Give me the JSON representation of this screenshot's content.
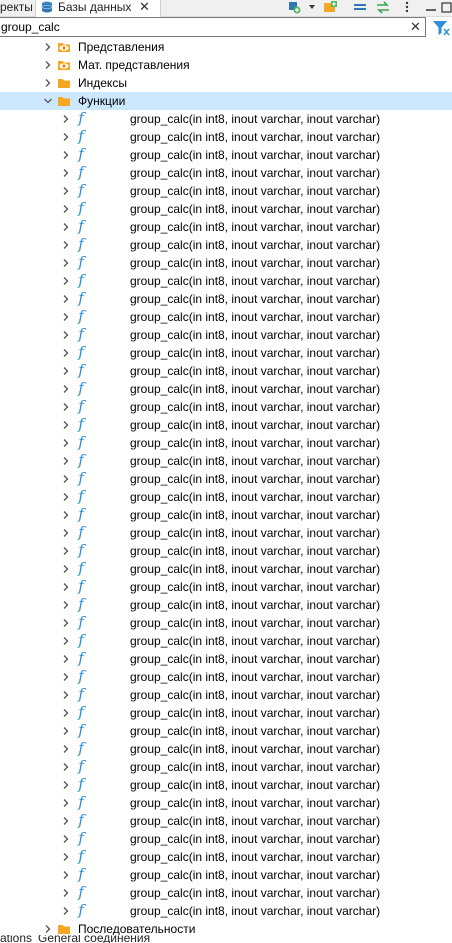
{
  "tabs": {
    "prev_label": "ректы",
    "active_label": "Базы данных"
  },
  "filter": {
    "value": "group_calc"
  },
  "tree": {
    "folders_top": [
      {
        "label": "Представления",
        "icon": "eye-folder-icon",
        "expanded": false
      },
      {
        "label": "Мат. представления",
        "icon": "eye-folder-icon",
        "expanded": false
      },
      {
        "label": "Индексы",
        "icon": "folder-icon",
        "expanded": false
      },
      {
        "label": "Функции",
        "icon": "folder-icon",
        "expanded": true
      }
    ],
    "function_label": "group_calc(in int8, inout varchar, inout varchar)",
    "function_count": 45,
    "folder_bottom": {
      "label": "Последовательности",
      "icon": "folder-icon",
      "expanded": false
    }
  },
  "statusbar": {
    "left": "ations",
    "right": "General соединения"
  },
  "colors": {
    "selection": "#cce8ff",
    "function_icon": "#2b8fd8",
    "folder": "#f5a623"
  }
}
